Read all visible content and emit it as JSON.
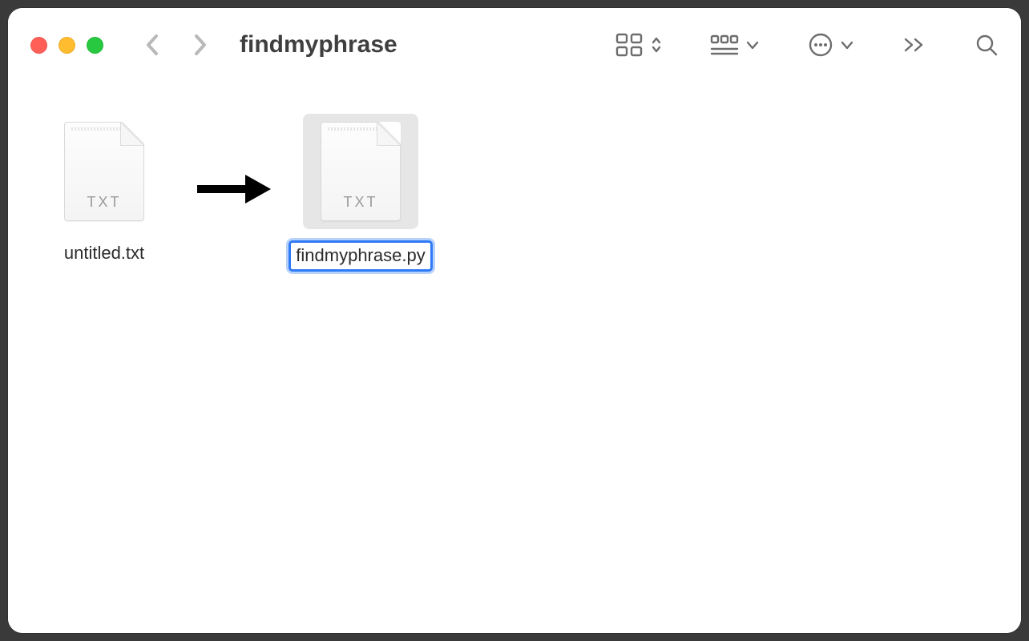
{
  "window": {
    "title": "findmyphrase"
  },
  "files": [
    {
      "name": "untitled.txt",
      "ext": "TXT",
      "selected": false,
      "editing": false
    },
    {
      "name": "findmyphrase.py",
      "ext": "TXT",
      "selected": true,
      "editing": true
    }
  ],
  "annotation": {
    "arrow": "rename-arrow"
  }
}
